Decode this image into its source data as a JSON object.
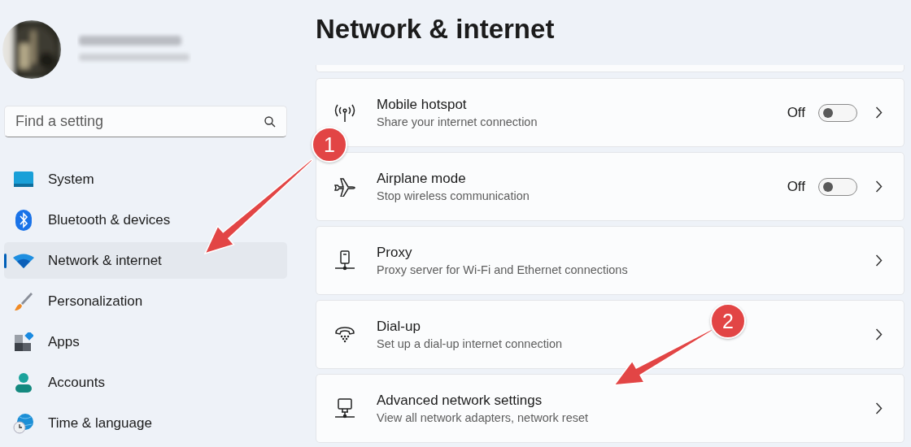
{
  "sidebar": {
    "search": {
      "placeholder": "Find a setting"
    },
    "items": [
      {
        "label": "System",
        "selected": false
      },
      {
        "label": "Bluetooth & devices",
        "selected": false
      },
      {
        "label": "Network & internet",
        "selected": true
      },
      {
        "label": "Personalization",
        "selected": false
      },
      {
        "label": "Apps",
        "selected": false
      },
      {
        "label": "Accounts",
        "selected": false
      },
      {
        "label": "Time & language",
        "selected": false
      }
    ]
  },
  "page_title": "Network & internet",
  "settings": [
    {
      "kind": "toggle",
      "title": "Mobile hotspot",
      "description": "Share your internet connection",
      "state_label": "Off",
      "on": false
    },
    {
      "kind": "toggle",
      "title": "Airplane mode",
      "description": "Stop wireless communication",
      "state_label": "Off",
      "on": false
    },
    {
      "kind": "link",
      "title": "Proxy",
      "description": "Proxy server for Wi-Fi and Ethernet connections"
    },
    {
      "kind": "link",
      "title": "Dial-up",
      "description": "Set up a dial-up internet connection"
    },
    {
      "kind": "link",
      "title": "Advanced network settings",
      "description": "View all network adapters, network reset"
    }
  ],
  "annotations": [
    {
      "number": "1"
    },
    {
      "number": "2"
    }
  ]
}
